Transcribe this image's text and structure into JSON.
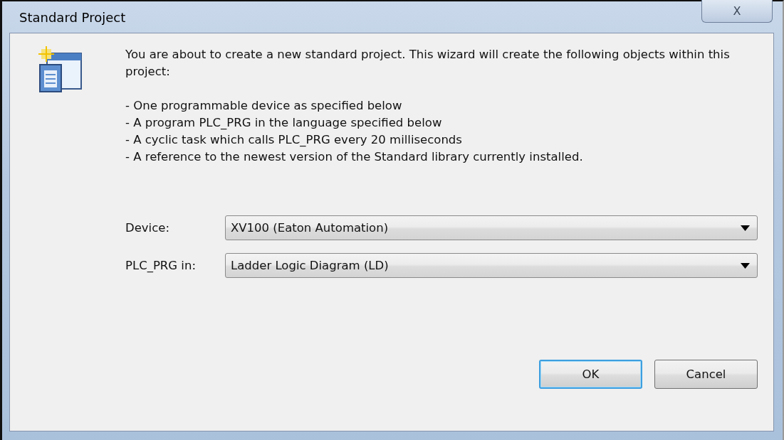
{
  "window": {
    "title": "Standard Project",
    "close_label": "X"
  },
  "intro": "You are about to create a new standard project. This wizard will create the following objects within this project:",
  "items": [
    "- One programmable device as specified below",
    "- A program PLC_PRG in the language specified below",
    "- A cyclic task which calls PLC_PRG every 20 milliseconds",
    "- A reference to the newest version of the Standard library currently installed."
  ],
  "fields": [
    {
      "label": "Device:",
      "value": "XV100 (Eaton Automation)"
    },
    {
      "label": "PLC_PRG in:",
      "value": "Ladder Logic Diagram (LD)"
    }
  ],
  "buttons": [
    {
      "label": "OK",
      "default": true
    },
    {
      "label": "Cancel",
      "default": false
    }
  ]
}
